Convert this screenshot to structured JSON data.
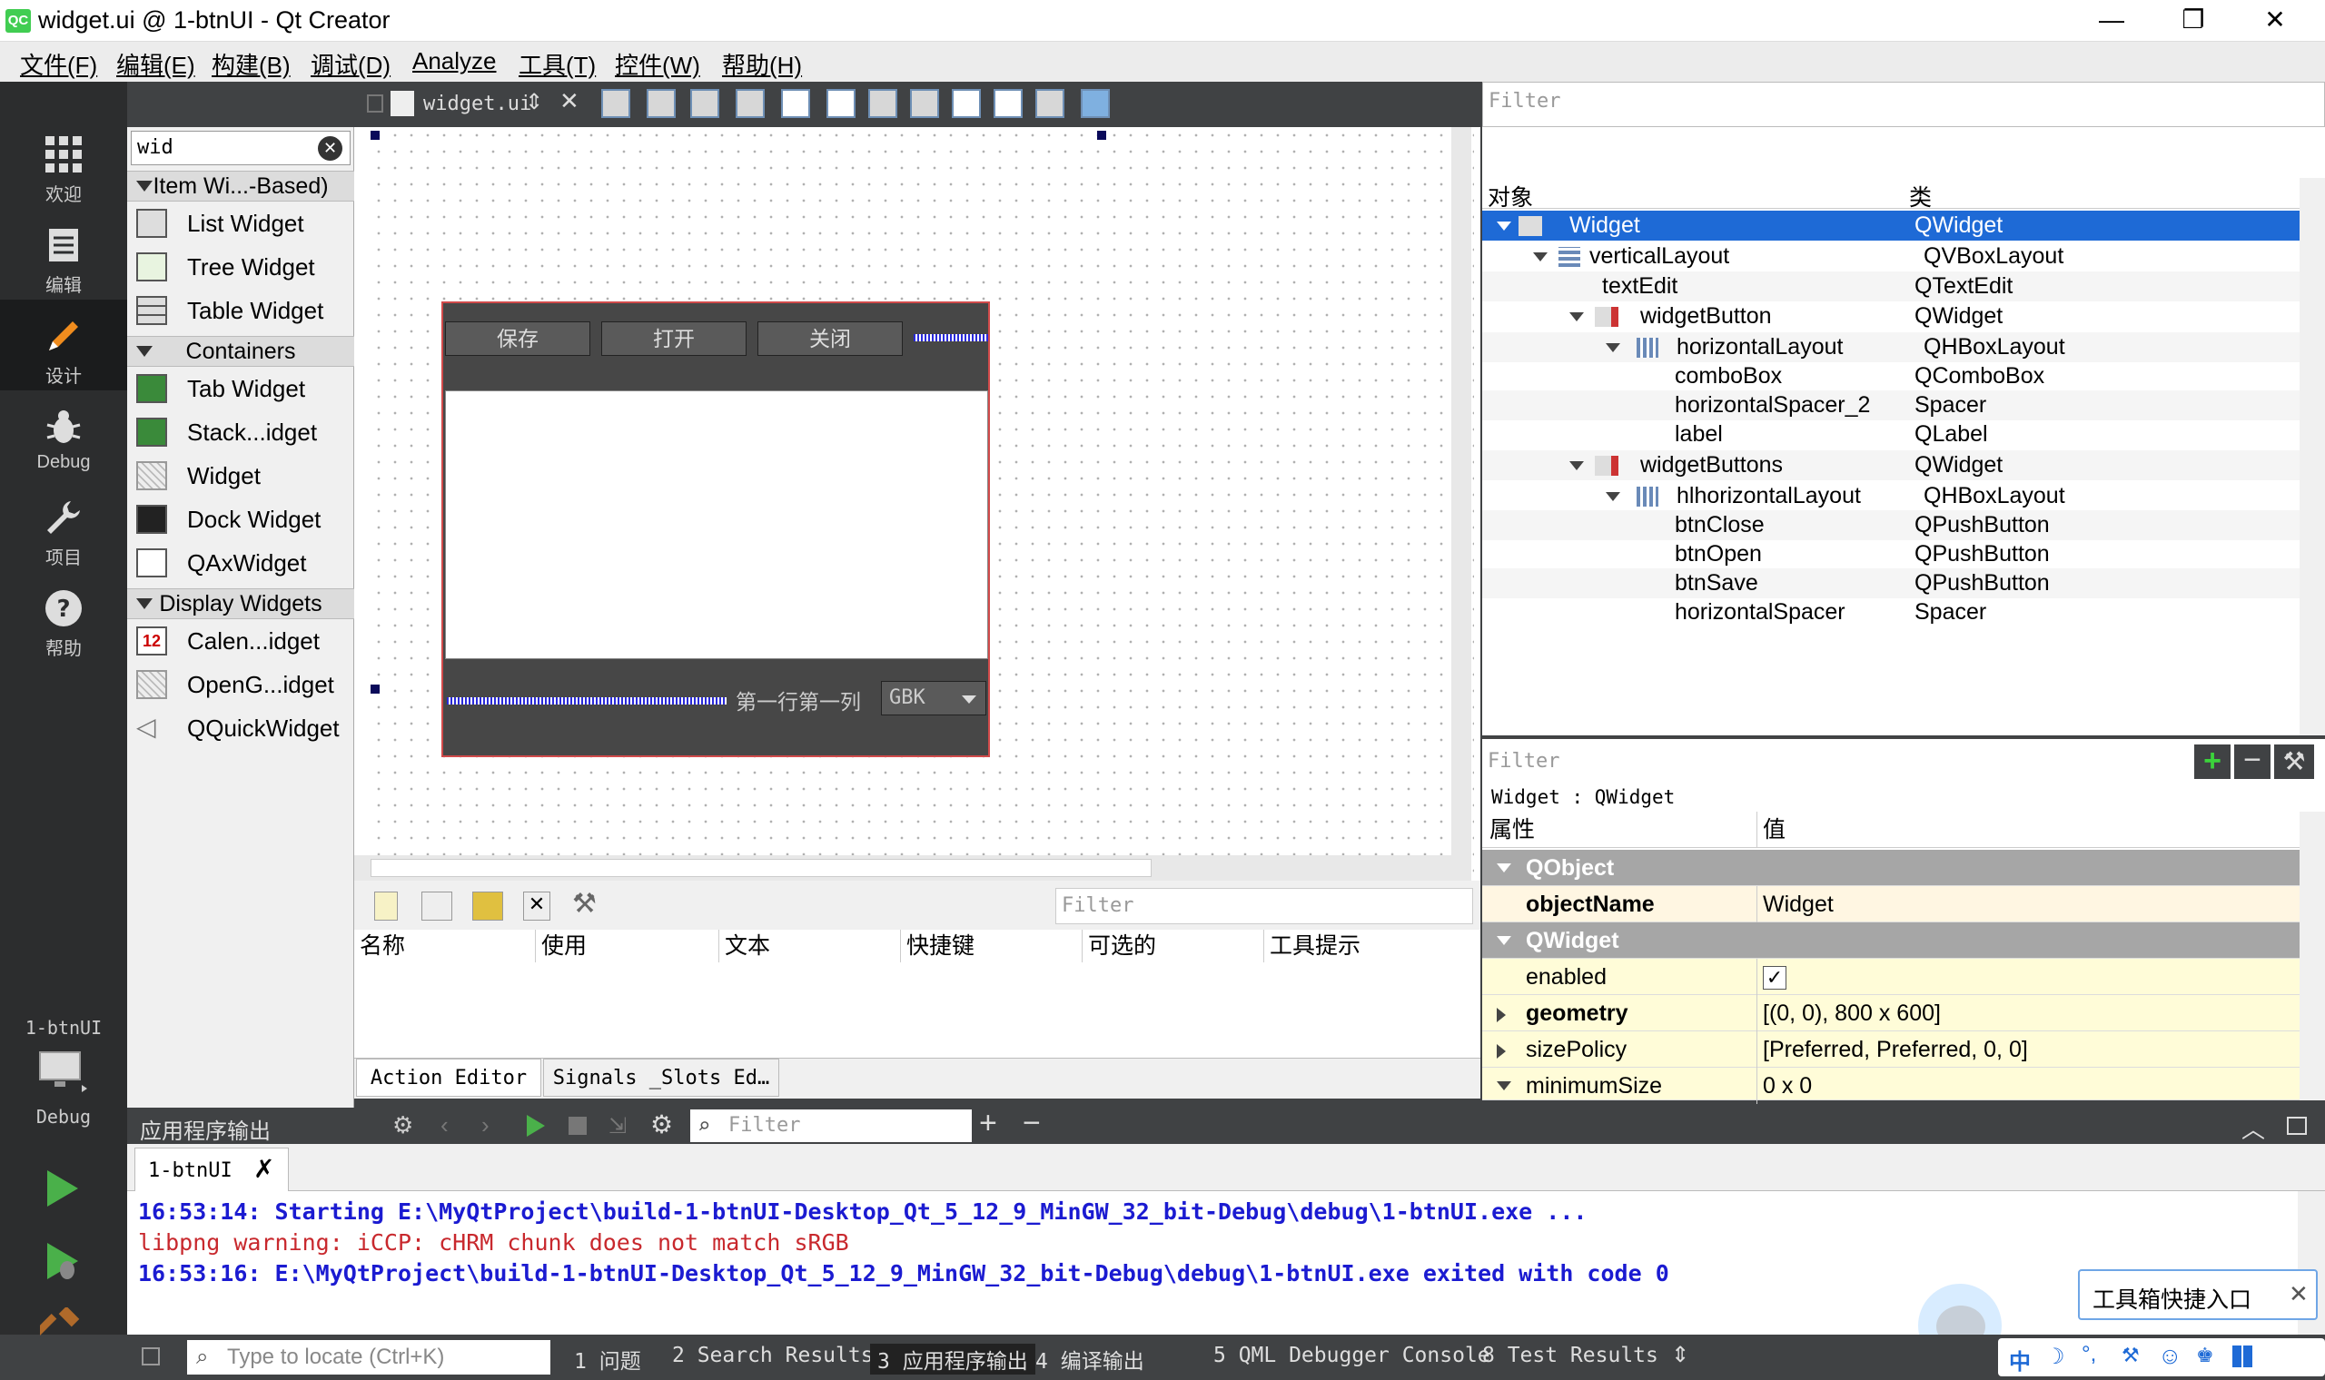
{
  "window": {
    "title": "widget.ui @ 1-btnUI - Qt Creator",
    "app_icon": "QC"
  },
  "menu": [
    "文件(F)",
    "编辑(E)",
    "构建(B)",
    "调试(D)",
    "Analyze",
    "工具(T)",
    "控件(W)",
    "帮助(H)"
  ],
  "modes": [
    {
      "label": "欢迎",
      "icon": "grid-icon"
    },
    {
      "label": "编辑",
      "icon": "document-icon"
    },
    {
      "label": "设计",
      "icon": "pencil-icon"
    },
    {
      "label": "Debug",
      "icon": "bug-icon"
    },
    {
      "label": "项目",
      "icon": "wrench-icon"
    },
    {
      "label": "帮助",
      "icon": "help-icon"
    }
  ],
  "kit": {
    "project": "1-btnUI",
    "build": "Debug"
  },
  "widgetbox": {
    "filter_value": "wid",
    "cat1": "Item Wi...-Based)",
    "list_widget": "List Widget",
    "tree_widget": "Tree Widget",
    "table_widget": "Table Widget",
    "cat2": "Containers",
    "tab_widget": "Tab Widget",
    "stack_widget": "Stack...idget",
    "widget": "Widget",
    "dock_widget": "Dock Widget",
    "qax_widget": "QAxWidget",
    "cat3": "Display Widgets",
    "calendar": "Calen...idget",
    "opengl": "OpenG...idget",
    "quick": "QQuickWidget"
  },
  "editor": {
    "file": "widget.ui",
    "save": "保存",
    "open": "打开",
    "close": "关闭",
    "label": "第一行第一列",
    "combo": "GBK"
  },
  "action_editor": {
    "filter": "Filter",
    "headers": [
      "名称",
      "使用",
      "文本",
      "快捷键",
      "可选的",
      "工具提示"
    ],
    "tab1": "Action Editor",
    "tab2": "Signals _Slots Ed…"
  },
  "object_inspector": {
    "filter": "Filter",
    "col_object": "对象",
    "col_class": "类",
    "rows": [
      {
        "name": "Widget",
        "cls": "QWidget"
      },
      {
        "name": "verticalLayout",
        "cls": "QVBoxLayout"
      },
      {
        "name": "textEdit",
        "cls": "QTextEdit"
      },
      {
        "name": "widgetButton",
        "cls": "QWidget"
      },
      {
        "name": "horizontalLayout",
        "cls": "QHBoxLayout"
      },
      {
        "name": "comboBox",
        "cls": "QComboBox"
      },
      {
        "name": "horizontalSpacer_2",
        "cls": "Spacer"
      },
      {
        "name": "label",
        "cls": "QLabel"
      },
      {
        "name": "widgetButtons",
        "cls": "QWidget"
      },
      {
        "name": "hlhorizontalLayout",
        "cls": "QHBoxLayout"
      },
      {
        "name": "btnClose",
        "cls": "QPushButton"
      },
      {
        "name": "btnOpen",
        "cls": "QPushButton"
      },
      {
        "name": "btnSave",
        "cls": "QPushButton"
      },
      {
        "name": "horizontalSpacer",
        "cls": "Spacer"
      }
    ]
  },
  "property_editor": {
    "filter": "Filter",
    "context": "Widget : QWidget",
    "col_prop": "属性",
    "col_value": "值",
    "grp_qobject": "QObject",
    "objectName": "objectName",
    "objectName_val": "Widget",
    "grp_qwidget": "QWidget",
    "enabled": "enabled",
    "enabled_val": "✓",
    "geometry": "geometry",
    "geometry_val": "[(0, 0), 800 x 600]",
    "sizePolicy": "sizePolicy",
    "sizePolicy_val": "[Preferred, Preferred, 0, 0]",
    "minimumSize": "minimumSize",
    "minimumSize_val": "0 x 0"
  },
  "output": {
    "title": "应用程序输出",
    "filter": "Filter",
    "tab": "1-btnUI",
    "lines": [
      "16:53:14: Starting E:\\MyQtProject\\build-1-btnUI-Desktop_Qt_5_12_9_MinGW_32_bit-Debug\\debug\\1-btnUI.exe ...",
      "libpng warning: iCCP: cHRM chunk does not match sRGB",
      "16:53:16: E:\\MyQtProject\\build-1-btnUI-Desktop_Qt_5_12_9_MinGW_32_bit-Debug\\debug\\1-btnUI.exe exited with code 0"
    ],
    "toolbox_tip": "工具箱快捷入口"
  },
  "status": {
    "locate": "Type to locate (Ctrl+K)",
    "tabs": [
      "1 问题",
      "2 Search Results",
      "3 应用程序输出",
      "4 编译输出",
      "5 QML Debugger Console",
      "8 Test Results"
    ]
  },
  "colors": {
    "accent": "#1e6ad6",
    "output_text": "#1b1bd1",
    "warning_text": "#c8282d",
    "run_green": "#4ab04a"
  }
}
